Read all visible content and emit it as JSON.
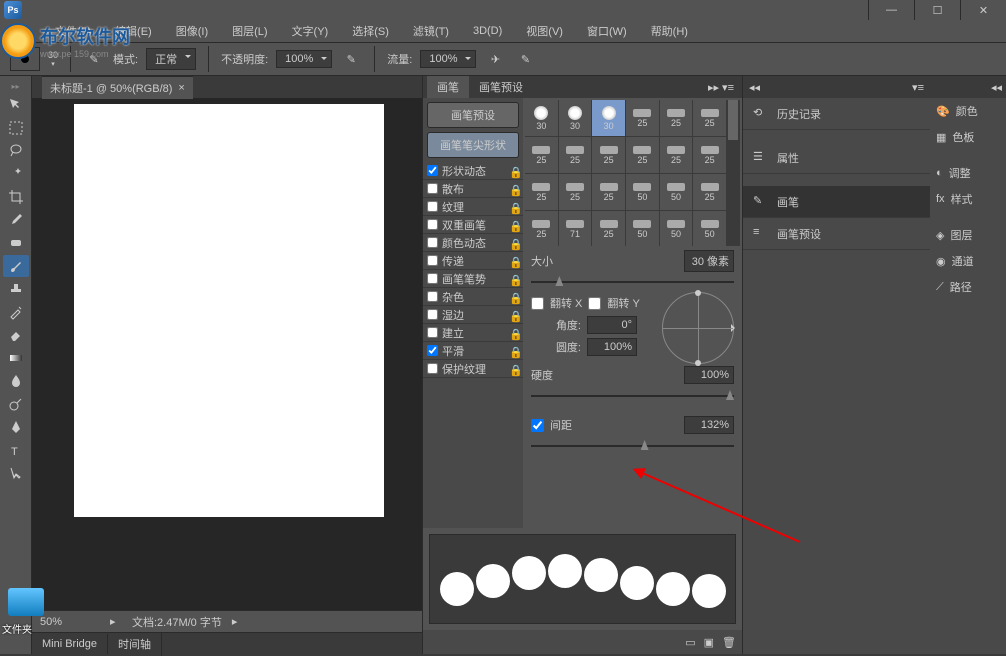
{
  "menu": {
    "file": "文件(F)",
    "edit": "编辑(E)",
    "image": "图像(I)",
    "layer": "图层(L)",
    "type": "文字(Y)",
    "select": "选择(S)",
    "filter": "滤镜(T)",
    "threeD": "3D(D)",
    "view": "视图(V)",
    "window": "窗口(W)",
    "help": "帮助(H)"
  },
  "options": {
    "brush_size": "30",
    "mode_label": "模式:",
    "mode_value": "正常",
    "opacity_label": "不透明度:",
    "opacity_value": "100%",
    "flow_label": "流量:",
    "flow_value": "100%"
  },
  "watermark": {
    "text": "布尔软件网",
    "url": "www.pe 159.com"
  },
  "doc": {
    "tab": "未标题-1 @ 50%(RGB/8)",
    "zoom": "50%",
    "status": "文档:2.47M/0 字节"
  },
  "bottom_tabs": {
    "mini": "Mini Bridge",
    "timeline": "时间轴"
  },
  "brush_panel": {
    "tab1": "画笔",
    "tab2": "画笔预设",
    "preset_btn": "画笔预设",
    "tip_btn": "画笔笔尖形状",
    "rows": [
      "形状动态",
      "散布",
      "纹理",
      "双重画笔",
      "颜色动态",
      "传递",
      "画笔笔势",
      "杂色",
      "湿边",
      "建立",
      "平滑",
      "保护纹理"
    ],
    "row_checked": [
      true,
      false,
      false,
      false,
      false,
      false,
      false,
      false,
      false,
      false,
      true,
      false
    ],
    "size_label": "大小",
    "size_value": "30 像素",
    "flip_x": "翻转 X",
    "flip_y": "翻转 Y",
    "angle_label": "角度:",
    "angle_value": "0°",
    "round_label": "圆度:",
    "round_value": "100%",
    "hardness_label": "硬度",
    "hardness_value": "100%",
    "spacing_label": "间距",
    "spacing_value": "132%",
    "tips": [
      {
        "v": "30"
      },
      {
        "v": "30"
      },
      {
        "v": "30"
      },
      {
        "v": "25"
      },
      {
        "v": "25"
      },
      {
        "v": "25"
      },
      {
        "v": "25"
      },
      {
        "v": "25"
      },
      {
        "v": "25"
      },
      {
        "v": "25"
      },
      {
        "v": "25"
      },
      {
        "v": "25"
      },
      {
        "v": "25"
      },
      {
        "v": "25"
      },
      {
        "v": "25"
      },
      {
        "v": "50"
      },
      {
        "v": "50"
      },
      {
        "v": "25"
      },
      {
        "v": "25"
      },
      {
        "v": "71"
      },
      {
        "v": "25"
      },
      {
        "v": "50"
      },
      {
        "v": "50"
      },
      {
        "v": "50"
      }
    ]
  },
  "right_col": {
    "history": "历史记录",
    "props": "属性",
    "brush": "画笔",
    "brush_preset": "画笔预设"
  },
  "far_right": {
    "color": "颜色",
    "swatch": "色板",
    "adjust": "调整",
    "style": "样式",
    "layer": "图层",
    "channel": "通道",
    "path": "路径"
  },
  "desktop": {
    "folder": "文件夹"
  }
}
